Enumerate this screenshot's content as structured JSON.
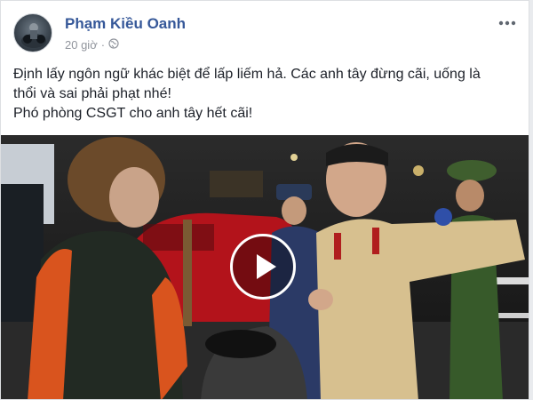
{
  "post": {
    "author": "Phạm Kiều Oanh",
    "timestamp": "20 giờ",
    "separator": "·",
    "privacy_icon": "globe-icon",
    "more_icon": "more-options-icon",
    "text_lines": [
      "Định lấy ngôn ngữ khác biệt để lấp liếm hả. Các anh tây đừng cãi, uống là",
      "thổi và sai phải phạt nhé!",
      "Phó phòng CSGT cho anh tây hết cãi!"
    ]
  },
  "video": {
    "play_icon": "play-icon"
  },
  "colors": {
    "author_link": "#365899",
    "meta_text": "#90949c",
    "body_text": "#1d2129",
    "page_bg": "#e9ebee"
  }
}
